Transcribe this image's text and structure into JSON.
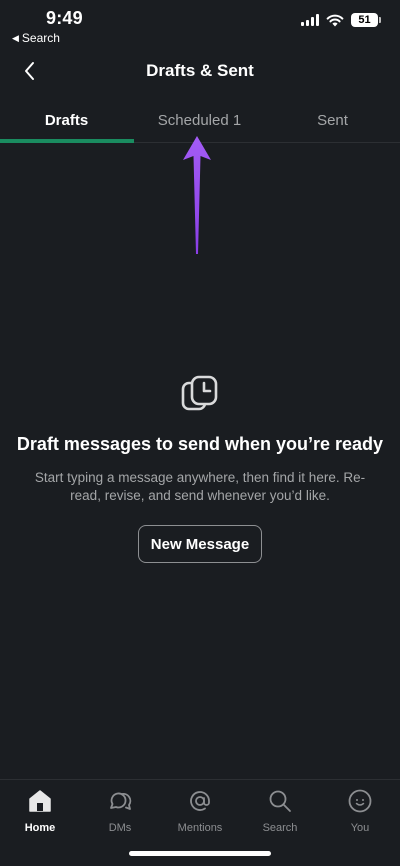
{
  "status_bar": {
    "time": "9:49",
    "back_app_label": "Search",
    "battery_level": "51"
  },
  "header": {
    "title": "Drafts & Sent"
  },
  "tabs": [
    {
      "label": "Drafts",
      "active": true
    },
    {
      "label": "Scheduled 1",
      "active": false
    },
    {
      "label": "Sent",
      "active": false
    }
  ],
  "empty_state": {
    "icon": "drafts-copy-icon",
    "title": "Draft messages to send when you’re ready",
    "description": "Start typing a message anywhere, then find it here. Re-read, revise, and send whenever you’d like.",
    "button_label": "New Message"
  },
  "bottom_nav": [
    {
      "label": "Home",
      "icon": "home-icon",
      "active": true
    },
    {
      "label": "DMs",
      "icon": "dms-icon",
      "active": false
    },
    {
      "label": "Mentions",
      "icon": "at-icon",
      "active": false
    },
    {
      "label": "Search",
      "icon": "search-icon",
      "active": false
    },
    {
      "label": "You",
      "icon": "you-icon",
      "active": false
    }
  ],
  "colors": {
    "background": "#1a1d21",
    "tab_underline": "#1a8c60",
    "annotation_arrow": "#9b4ff0",
    "muted_text": "#a4a6a8"
  }
}
